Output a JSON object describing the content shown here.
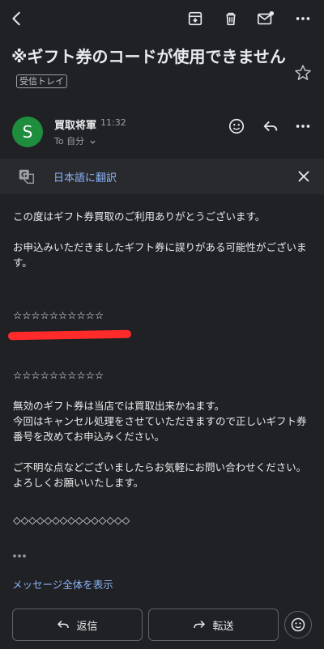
{
  "toolbar": {
    "back_icon": "arrow-back-icon",
    "archive_icon": "archive-icon",
    "delete_icon": "trash-icon",
    "mark_unread_icon": "mail-unread-icon",
    "more_icon": "more-vert-icon"
  },
  "email": {
    "subject": "※ギフト券のコードが使用できません",
    "label": "受信トレイ",
    "sender_initial": "S",
    "sender": "買取将軍",
    "time": "11:32",
    "recipient": "To 自分",
    "avatar_color": "#1e8e3e"
  },
  "translate": {
    "link": "日本語に翻訳"
  },
  "body": {
    "lines": [
      "この度はギフト券買取のご利用ありがとうございます。",
      "お申込みいただきましたギフト券に誤りがある可能性がございます。",
      "☆☆☆☆☆☆☆☆☆☆",
      "☆☆☆☆☆☆☆☆☆☆",
      "無効のギフト券は当店では買取出来かねます。",
      "今回はキャンセル処理をさせていただきますので正しいギフト券番号を改めてお申込みください。",
      "ご不明な点などございましたらお気軽にお問い合わせください。",
      "よろしくお願いいたします。",
      "◇◇◇◇◇◇◇◇◇◇◇◇◇◇◇"
    ]
  },
  "footer": {
    "show_all": "メッセージ全体を表示",
    "reply": "返信",
    "forward": "転送"
  },
  "colors": {
    "background": "#202124",
    "link": "#8ab4f8",
    "redaction": "#ff2b2b"
  }
}
